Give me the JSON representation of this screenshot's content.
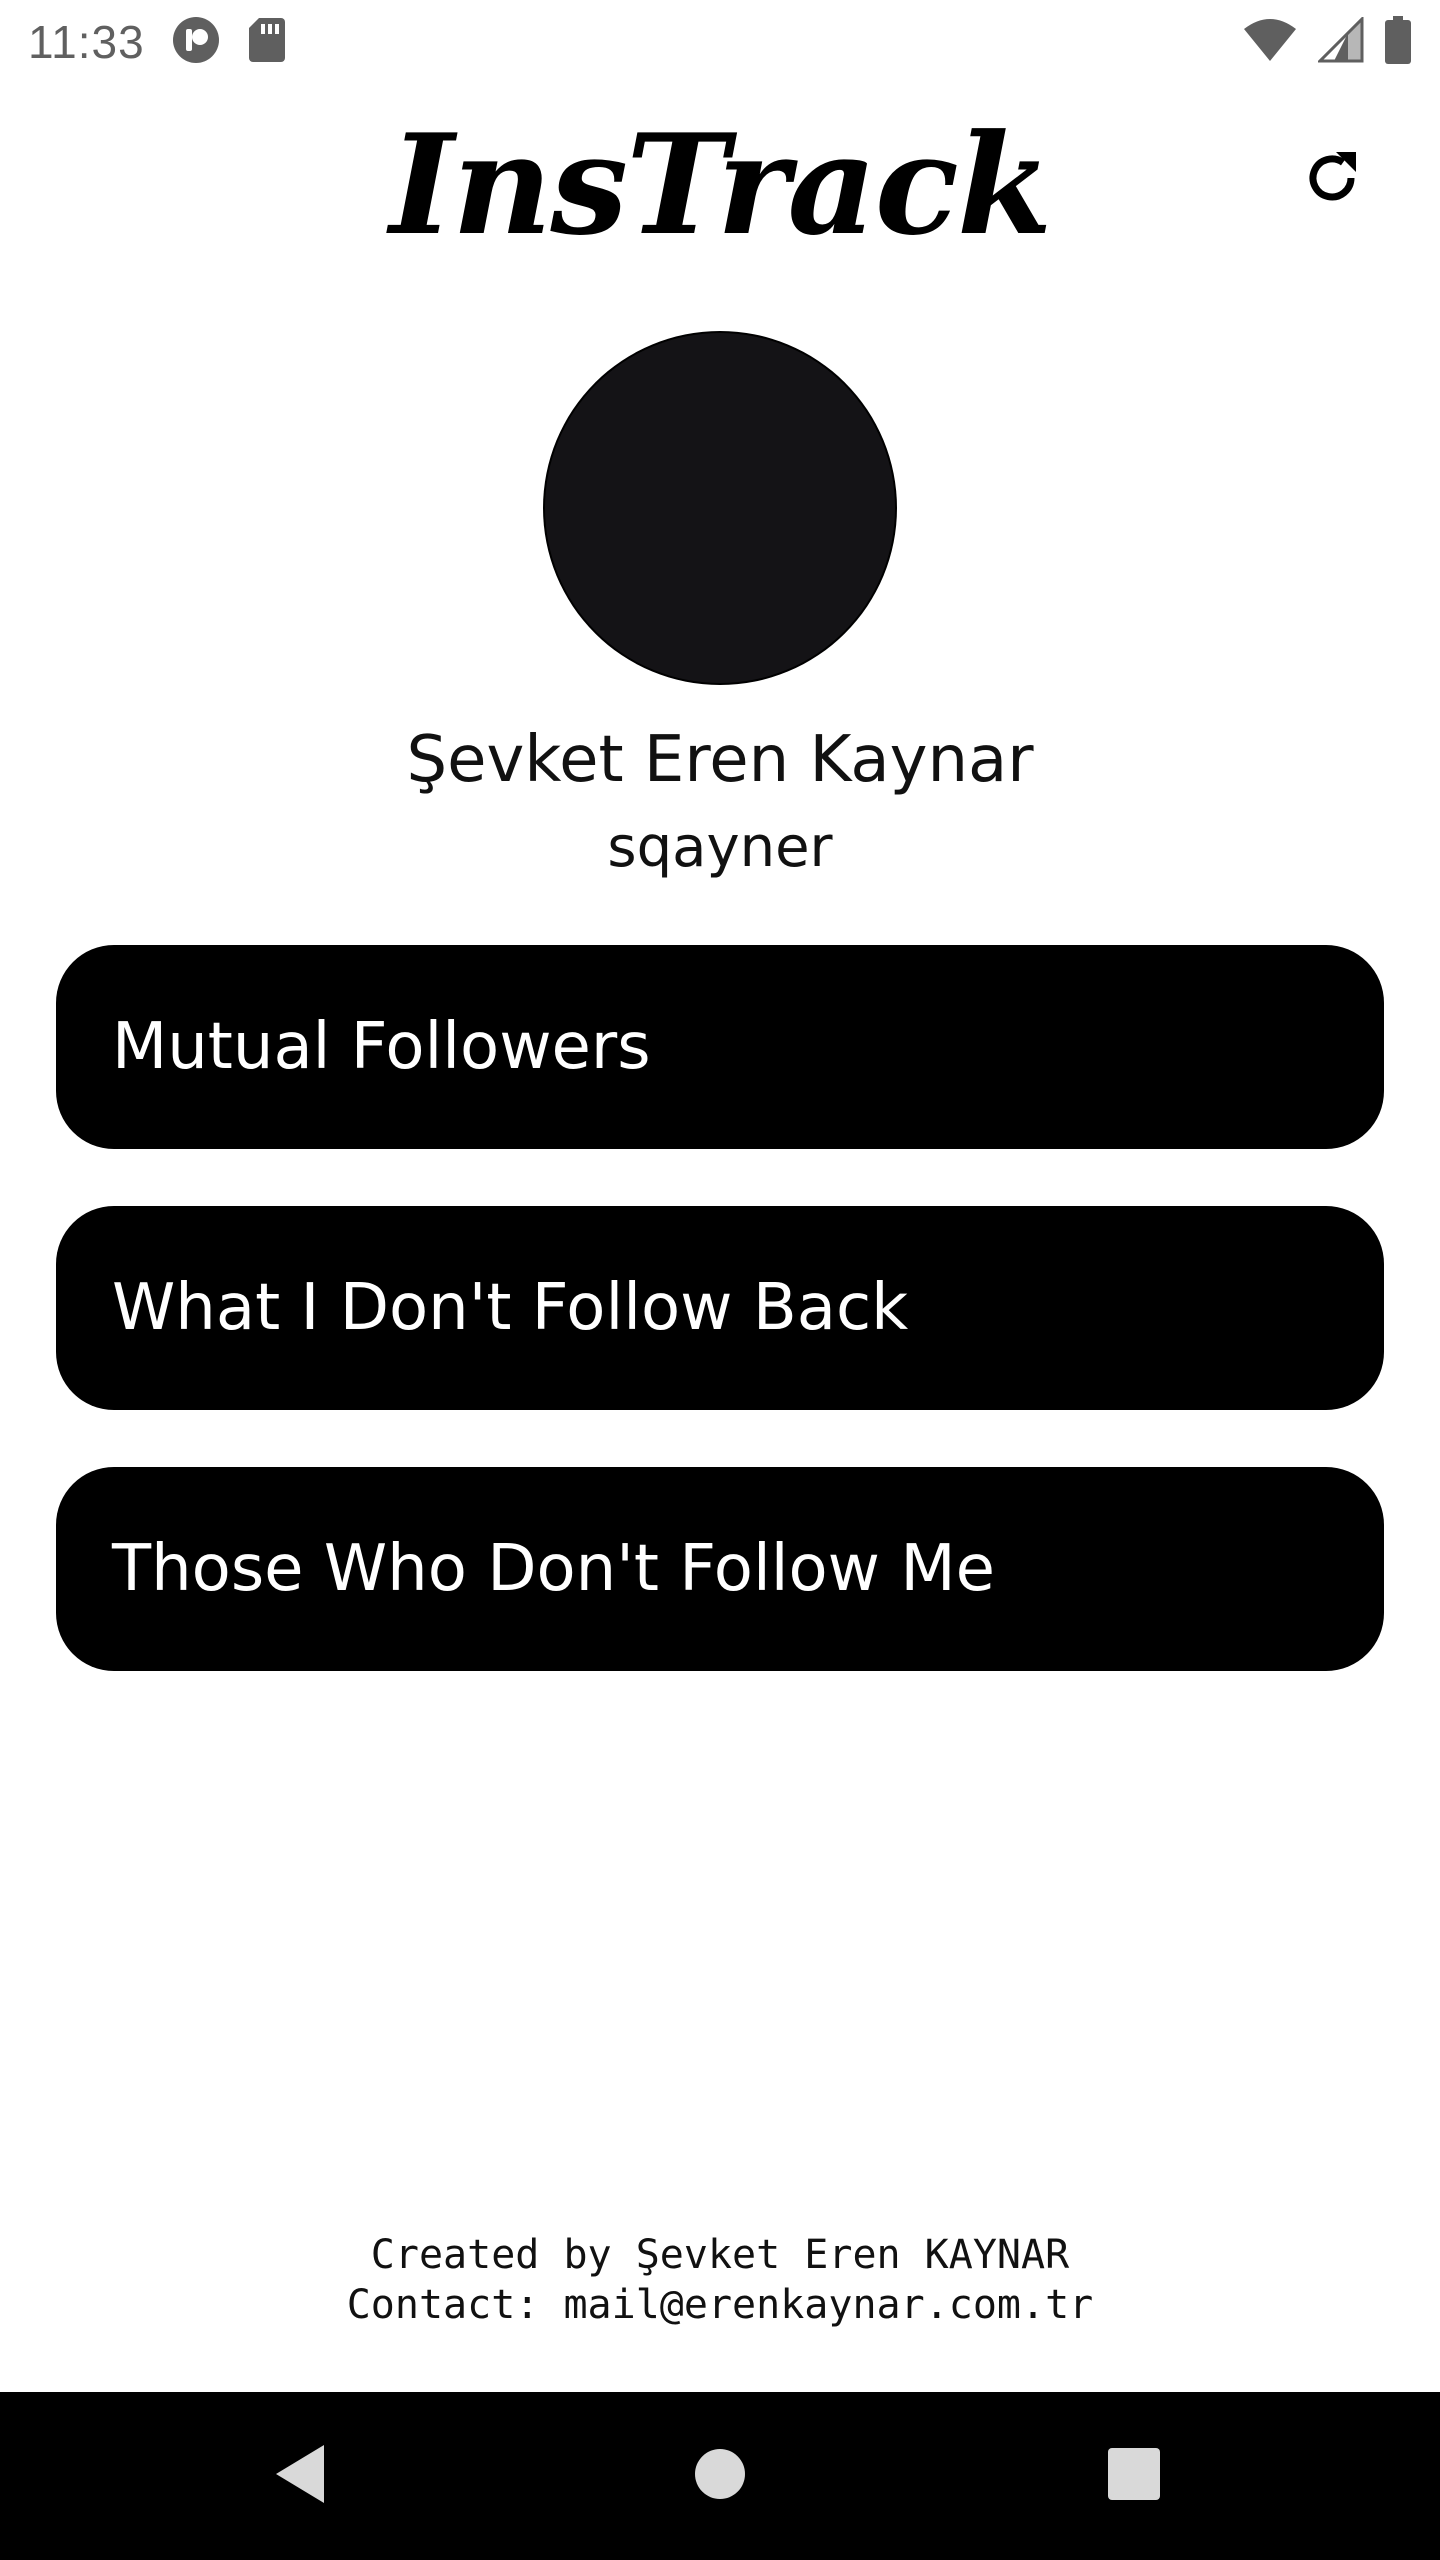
{
  "status_bar": {
    "time": "11:33",
    "icons": [
      "app-notification-icon",
      "sd-card-icon",
      "wifi-icon",
      "cell-signal-icon",
      "battery-icon"
    ]
  },
  "header": {
    "title": "InsTrack",
    "refresh_icon": "refresh-icon"
  },
  "profile": {
    "full_name": "Şevket Eren Kaynar",
    "username": "sqayner"
  },
  "menu": [
    {
      "label": "Mutual Followers"
    },
    {
      "label": "What I Don't Follow Back"
    },
    {
      "label": "Those Who Don't Follow Me"
    }
  ],
  "footer": {
    "created_by": "Created by Şevket Eren KAYNAR",
    "contact": "Contact: mail@erenkaynar.com.tr"
  },
  "nav_bar": {
    "icons": [
      "back-icon",
      "home-icon",
      "recents-icon"
    ]
  },
  "colors": {
    "background": "#ffffff",
    "button_bg": "#000000",
    "button_text": "#ffffff",
    "avatar": "#141316",
    "status_icons": "#5f5f5f"
  }
}
